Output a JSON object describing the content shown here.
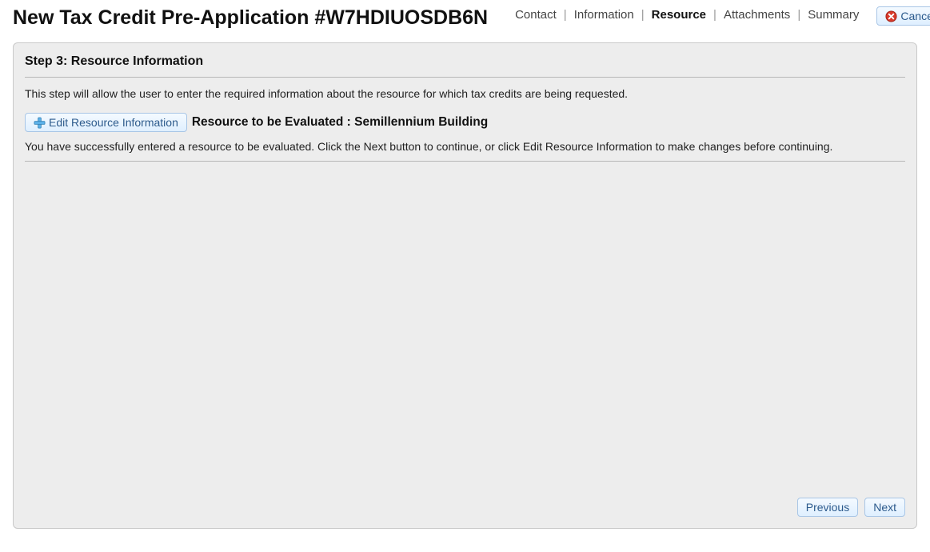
{
  "header": {
    "title": "New Tax Credit Pre-Application #W7HDIUOSDB6N",
    "cancel_label": "Cancel"
  },
  "nav": {
    "items": [
      "Contact",
      "Information",
      "Resource",
      "Attachments",
      "Summary"
    ],
    "active_index": 2
  },
  "step": {
    "title": "Step 3: Resource Information",
    "description": "This step will allow the user to enter the required information about the resource for which tax credits are being requested.",
    "edit_button_label": "Edit Resource Information",
    "resource_label": "Resource to be Evaluated : Semillennium Building",
    "success_message": "You have successfully entered a resource to be evaluated. Click the Next button to continue, or click Edit Resource Information to make changes before continuing."
  },
  "footer": {
    "previous_label": "Previous",
    "next_label": "Next"
  }
}
